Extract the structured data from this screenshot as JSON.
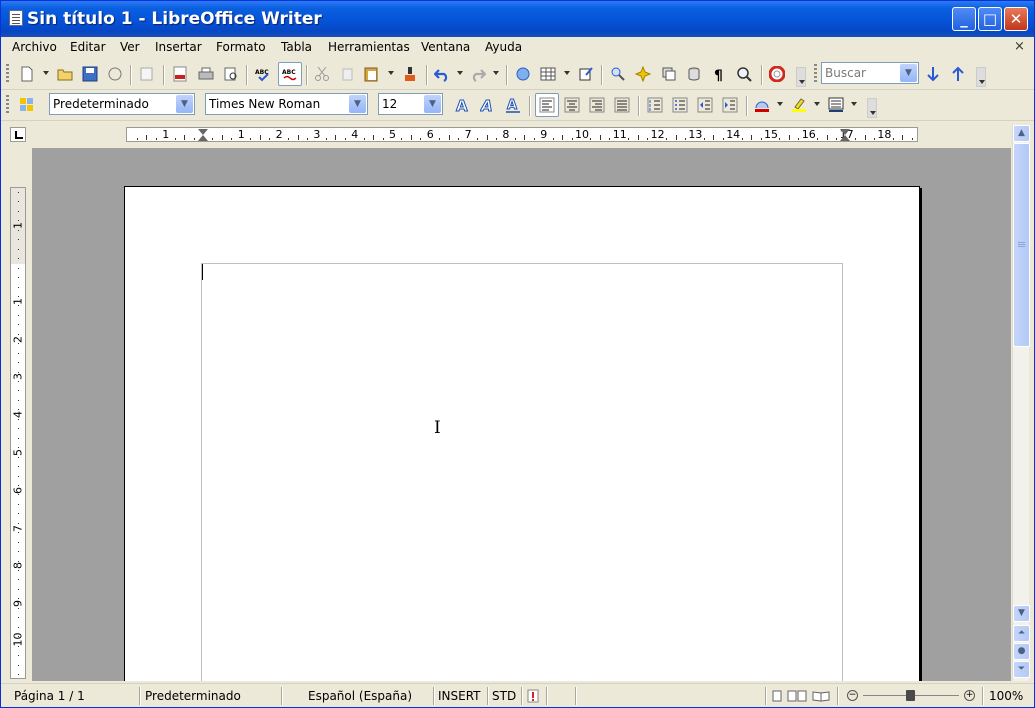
{
  "window": {
    "title": "Sin título 1 - LibreOffice Writer",
    "minimize_glyph": "_",
    "maximize_glyph": "□",
    "close_glyph": "✕"
  },
  "menubar": {
    "items": [
      "Archivo",
      "Editar",
      "Ver",
      "Insertar",
      "Formato",
      "Tabla",
      "Herramientas",
      "Ventana",
      "Ayuda"
    ],
    "close_document_glyph": "×"
  },
  "standard_toolbar": {
    "search_placeholder": "Buscar",
    "search_value": "Buscar"
  },
  "formatting_toolbar": {
    "paragraph_style": "Predeterminado",
    "font_name": "Times New Roman",
    "font_size": "12"
  },
  "ruler": {
    "horizontal_numbers": [
      "1",
      "1",
      "2",
      "3",
      "4",
      "5",
      "6",
      "7",
      "8",
      "9",
      "10",
      "11",
      "12",
      "13",
      "14",
      "15",
      "16",
      "17",
      "18"
    ],
    "vertical_numbers": [
      "1",
      "1",
      "2",
      "3",
      "4",
      "5",
      "6",
      "7",
      "8",
      "9",
      "10"
    ]
  },
  "statusbar": {
    "page": "Página  1 / 1",
    "page_style": "Predeterminado",
    "language": "Español (España)",
    "insert_mode": "INSERT",
    "selection_mode": "STD",
    "zoom": "100%"
  },
  "colors": {
    "titlebar": "#0553d8",
    "chrome": "#ece9d8",
    "canvas": "#a0a0a0"
  }
}
